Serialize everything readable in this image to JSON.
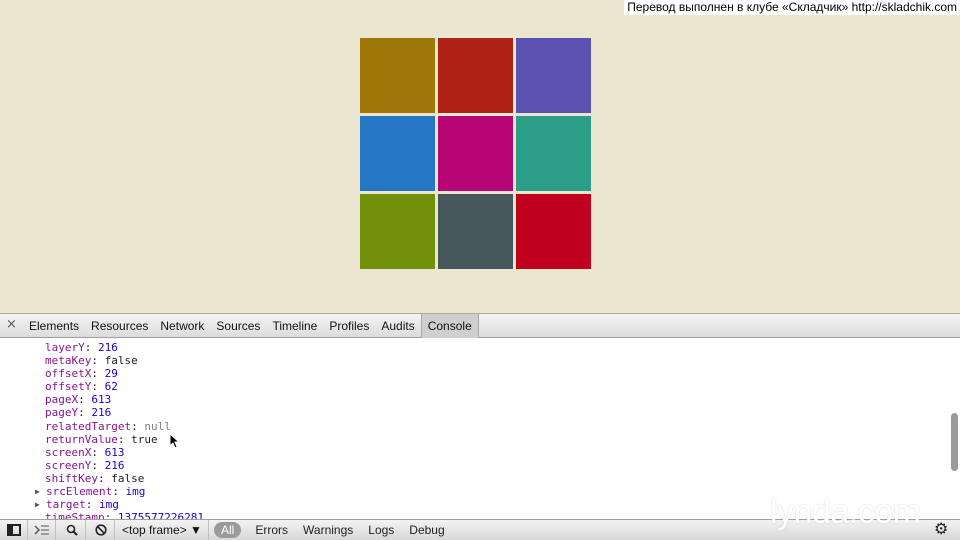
{
  "watermark": "Перевод выполнен в клубе «Складчик» http://skladchik.com",
  "tiles": [
    {
      "color": "#9e7708"
    },
    {
      "color": "#ae2315"
    },
    {
      "color": "#5a51b0"
    },
    {
      "color": "#2576c3"
    },
    {
      "color": "#b70575"
    },
    {
      "color": "#2c9e87"
    },
    {
      "color": "#729109"
    },
    {
      "color": "#47585d"
    },
    {
      "color": "#c1021f"
    }
  ],
  "devtools": {
    "close_icon": "×",
    "tabs": [
      "Elements",
      "Resources",
      "Network",
      "Sources",
      "Timeline",
      "Profiles",
      "Audits",
      "Console"
    ],
    "active_tab": "Console",
    "console_lines": [
      {
        "key": "layerY",
        "value": "216",
        "type": "num"
      },
      {
        "key": "metaKey",
        "value": "false",
        "type": "kw"
      },
      {
        "key": "offsetX",
        "value": "29",
        "type": "num"
      },
      {
        "key": "offsetY",
        "value": "62",
        "type": "num"
      },
      {
        "key": "pageX",
        "value": "613",
        "type": "num"
      },
      {
        "key": "pageY",
        "value": "216",
        "type": "num"
      },
      {
        "key": "relatedTarget",
        "value": "null",
        "type": "nil"
      },
      {
        "key": "returnValue",
        "value": "true",
        "type": "kw"
      },
      {
        "key": "screenX",
        "value": "613",
        "type": "num"
      },
      {
        "key": "screenY",
        "value": "216",
        "type": "num"
      },
      {
        "key": "shiftKey",
        "value": "false",
        "type": "kw"
      },
      {
        "key": "srcElement",
        "value": "img",
        "type": "obj",
        "expandable": true
      },
      {
        "key": "target",
        "value": "img",
        "type": "obj",
        "expandable": true
      },
      {
        "key": "timeStamp",
        "value": "1375577226281",
        "type": "num"
      }
    ],
    "status_bar": {
      "frame_selector": "<top frame> ▼",
      "filters": [
        "All",
        "Errors",
        "Warnings",
        "Logs",
        "Debug"
      ],
      "active_filter": "All"
    },
    "logo": "lynda.com"
  }
}
